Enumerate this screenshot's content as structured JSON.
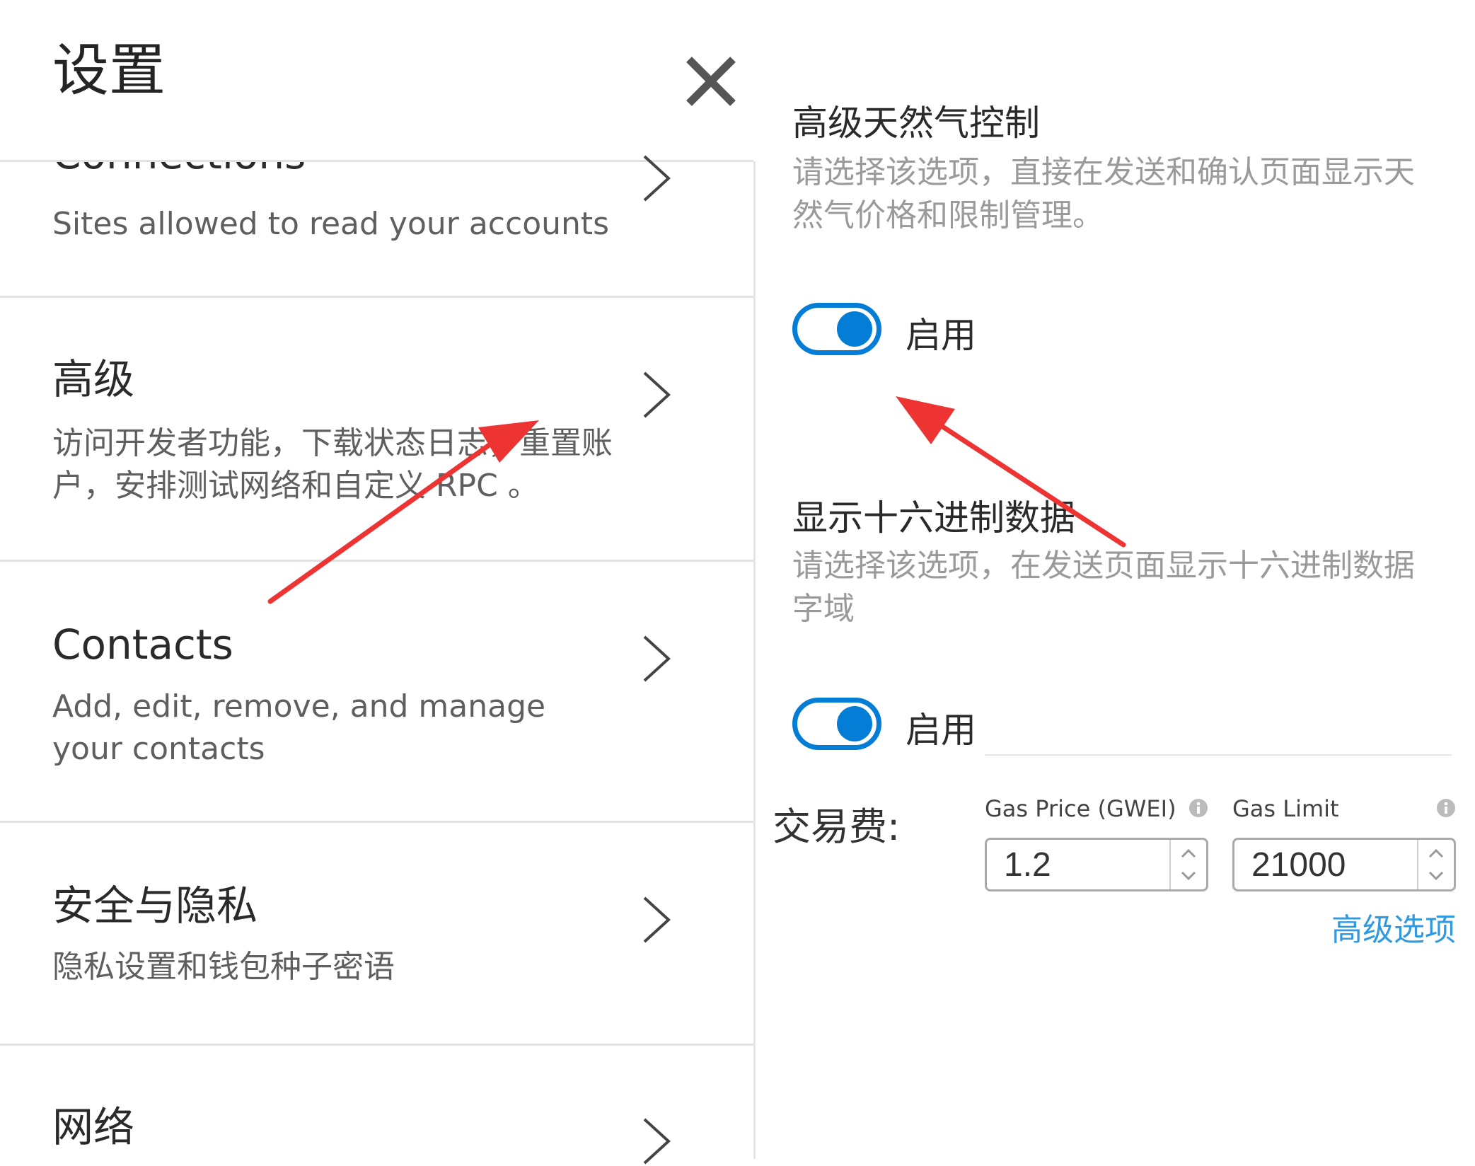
{
  "settings": {
    "title": "设置",
    "items": [
      {
        "title": "Connections",
        "desc": "Sites allowed to read your accounts"
      },
      {
        "title": "高级",
        "desc": "访问开发者功能，下载状态日志，重置账户，安排测试网络和自定义 RPC 。"
      },
      {
        "title": "Contacts",
        "desc": "Add, edit, remove, and manage your contacts"
      },
      {
        "title": "安全与隐私",
        "desc": "隐私设置和钱包种子密语"
      },
      {
        "title": "网络",
        "desc": ""
      }
    ]
  },
  "advanced": {
    "gas_control": {
      "title": "高级天然气控制",
      "desc": "请选择该选项，直接在发送和确认页面显示天然气价格和限制管理。",
      "toggle_label": "启用",
      "enabled": true
    },
    "hex_data": {
      "title": "显示十六进制数据",
      "desc": "请选择该选项，在发送页面显示十六进制数据字域",
      "toggle_label": "启用",
      "enabled": true
    }
  },
  "fee": {
    "label": "交易费:",
    "gas_price": {
      "label": "Gas Price (GWEI)",
      "value": "1.2"
    },
    "gas_limit": {
      "label": "Gas Limit",
      "value": "21000"
    },
    "advanced_link": "高级选项"
  },
  "colors": {
    "accent": "#037dd6",
    "link": "#2f9ae0",
    "annotation_arrow": "#ee3333"
  }
}
